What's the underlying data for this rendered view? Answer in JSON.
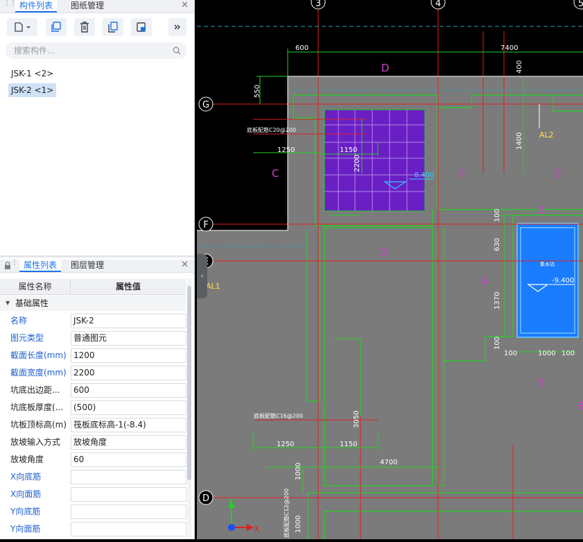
{
  "top_panel": {
    "tabs": [
      {
        "label": "构件列表"
      },
      {
        "label": "图纸管理"
      }
    ],
    "search_placeholder": "搜索构件...",
    "components": [
      {
        "label": "JSK-1 <2>"
      },
      {
        "label": "JSK-2 <1>"
      }
    ]
  },
  "bottom_panel": {
    "tabs": [
      {
        "label": "属性列表"
      },
      {
        "label": "图层管理"
      }
    ],
    "headers": {
      "name": "属性名称",
      "value": "属性值"
    },
    "group": "基础属性",
    "rows": [
      {
        "key": "名称",
        "value": "JSK-2",
        "color": "blue"
      },
      {
        "key": "图元类型",
        "value": "普通图元",
        "color": "blue"
      },
      {
        "key": "截面长度(mm)",
        "value": "1200",
        "color": "blue"
      },
      {
        "key": "截面宽度(mm)",
        "value": "2200",
        "color": "blue"
      },
      {
        "key": "坑底出边距...",
        "value": "600",
        "color": "black"
      },
      {
        "key": "坑底板厚度(...",
        "value": "(500)",
        "color": "black"
      },
      {
        "key": "坑板顶标高(m)",
        "value": "筏板底标高-1(-8.4)",
        "color": "black"
      },
      {
        "key": "放坡输入方式",
        "value": "放坡角度",
        "color": "black"
      },
      {
        "key": "放坡角度",
        "value": "60",
        "color": "black"
      },
      {
        "key": "X向底筋",
        "value": "",
        "color": "blue"
      },
      {
        "key": "X向面筋",
        "value": "",
        "color": "blue"
      },
      {
        "key": "Y向底筋",
        "value": "",
        "color": "blue"
      },
      {
        "key": "Y向面筋",
        "value": "",
        "color": "blue"
      }
    ]
  },
  "drawing": {
    "axes": {
      "a3": "3",
      "a4": "4",
      "a5": "5",
      "aG": "G",
      "aF": "F",
      "aE": "E",
      "aD": "D"
    },
    "dims": {
      "d600": "600",
      "d7400": "7400",
      "d400": "400",
      "d550": "550",
      "d1400": "1400",
      "d1250a": "1250",
      "d1150a": "1150",
      "d2200": "2200",
      "d100a": "100",
      "d630": "630",
      "d1370": "1370",
      "d100b": "100",
      "d100c": "100",
      "d1000": "1000",
      "d100d": "100",
      "d3050": "3050",
      "d1250b": "1250",
      "d1150b": "1150",
      "d4700": "4700",
      "d1000b": "1000",
      "d1000c": "1000"
    },
    "labels": {
      "D1": "D",
      "C1": "C",
      "C2": "C",
      "C3": "C",
      "D2": "D",
      "B1": "B",
      "B2": "B",
      "B3": "B",
      "A1": "A",
      "AL1": "AL1",
      "AL2": "AL2",
      "lev1": "-8.400",
      "lev2": "-9.400",
      "note1": "底板配筋C20@200",
      "note2": "底板配筋C16@200",
      "note3": "底板配筋C12@200",
      "pitname": "集水坑",
      "axis_x": "X",
      "axis_y": "Y"
    }
  }
}
